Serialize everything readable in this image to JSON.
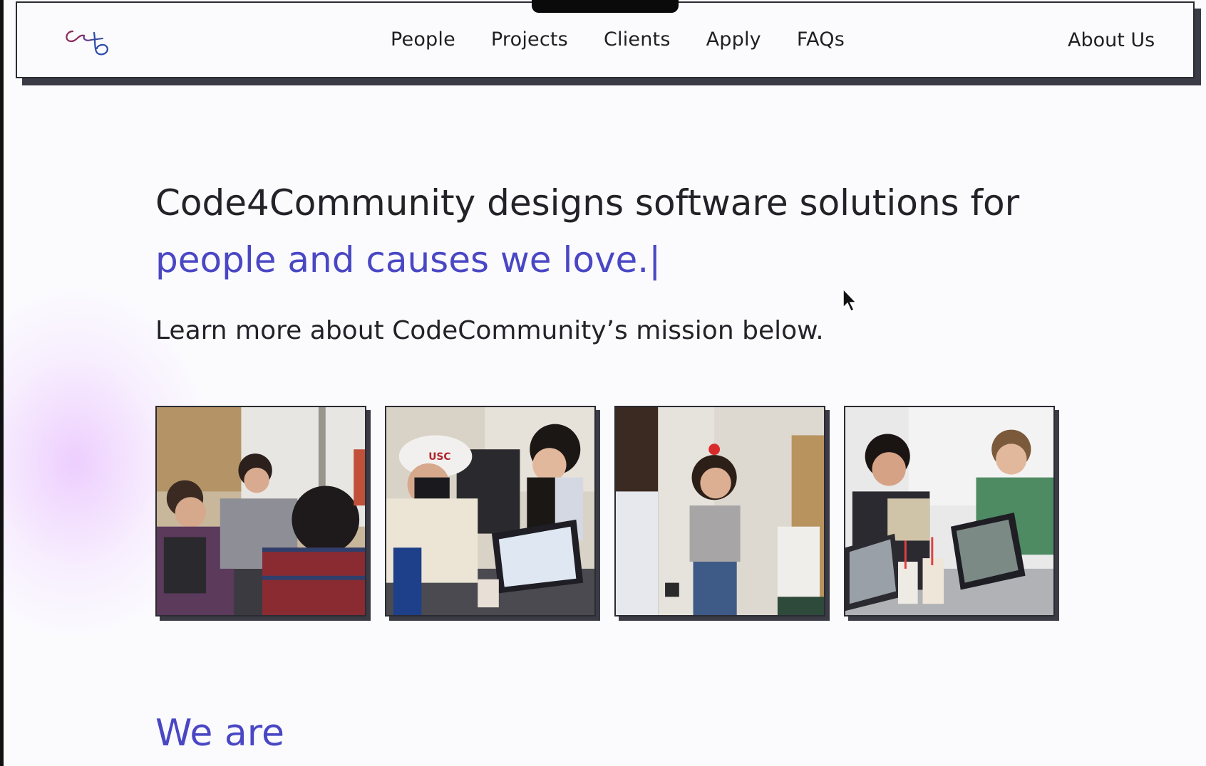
{
  "nav": {
    "logo_alt": "c4c logo",
    "links": [
      "People",
      "Projects",
      "Clients",
      "Apply",
      "FAQs"
    ],
    "about": "About Us"
  },
  "hero": {
    "title_main": "Code4Community designs software solutions for",
    "title_accent": "people and causes we love.",
    "caret": "|",
    "subtitle": "Learn more about CodeCommunity’s mission below."
  },
  "photos": [
    {
      "name": "students-chatting-photo"
    },
    {
      "name": "students-laptop-usc-cap-photo"
    },
    {
      "name": "student-presenting-photo"
    },
    {
      "name": "students-working-laptops-photo"
    }
  ],
  "section": {
    "we_are": "We are"
  },
  "colors": {
    "accent": "#4a47c4",
    "text": "#222228",
    "border": "#2b2b33",
    "shadow": "#3b3b46",
    "background": "#fbfbfe"
  }
}
